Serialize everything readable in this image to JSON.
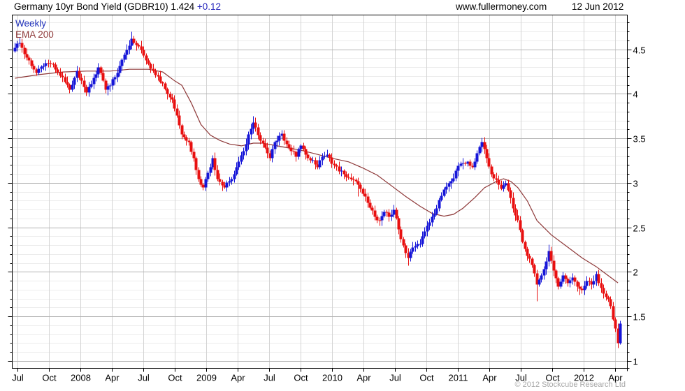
{
  "header": {
    "title": "Germany 10yr Bond Yield (GDBR10) 1.424",
    "change": "+0.12",
    "website": "www.fullermoney.com",
    "date": "12 Jun 2012"
  },
  "legend": {
    "frequency": "Weekly",
    "overlay": "EMA 200"
  },
  "footer": {
    "copyright": "© 2012 Stockcube Research Ltd"
  },
  "colors": {
    "up_candle": "#1616d8",
    "down_candle": "#e81010",
    "ema_line": "#8e3939",
    "accent_blue": "#2222bb",
    "grid_minor": "#ececec",
    "grid_major": "#b2b2b2",
    "grid_vertical": "#d4d4d4",
    "axis": "#000000",
    "copyright_gray": "#a6a6a6"
  },
  "chart_data": {
    "type": "candlestick",
    "title": "Germany 10yr Bond Yield (GDBR10)",
    "instrument": "Germany 10yr Bond Yield",
    "ticker": "GDBR10",
    "frequency": "Weekly",
    "overlay": "EMA 200",
    "last_price": 1.424,
    "change": "+0.12",
    "as_of_date": "12 Jun 2012",
    "legend_position": "top-left",
    "grid": true,
    "x_range_note": "weekly bars, Jul 2007 to 12 Jun 2012; t = weeks since first bar",
    "x_tick_labels": [
      "Jul",
      "Oct",
      "2008",
      "Apr",
      "Jul",
      "Oct",
      "2009",
      "Apr",
      "Jul",
      "Oct",
      "2010",
      "Apr",
      "Jul",
      "Oct",
      "2011",
      "Apr",
      "Jul",
      "Oct",
      "2012",
      "Apr"
    ],
    "y_tick_values": [
      1,
      1.5,
      2,
      2.5,
      3,
      3.5,
      4,
      4.5
    ],
    "y_minor_step": 0.1,
    "ylim": [
      0.92,
      4.89
    ],
    "weekly_close_anchors": [
      [
        0,
        4.52
      ],
      [
        2,
        4.58
      ],
      [
        4,
        4.45
      ],
      [
        6,
        4.38
      ],
      [
        9,
        4.24
      ],
      [
        12,
        4.32
      ],
      [
        15,
        4.34
      ],
      [
        18,
        4.25
      ],
      [
        21,
        4.14
      ],
      [
        23,
        4.05
      ],
      [
        26,
        4.26
      ],
      [
        28,
        4.15
      ],
      [
        30,
        4.02
      ],
      [
        33,
        4.18
      ],
      [
        35,
        4.3
      ],
      [
        38,
        4.05
      ],
      [
        40,
        4.1
      ],
      [
        43,
        4.24
      ],
      [
        46,
        4.44
      ],
      [
        49,
        4.62
      ],
      [
        51,
        4.55
      ],
      [
        53,
        4.5
      ],
      [
        55,
        4.38
      ],
      [
        58,
        4.26
      ],
      [
        60,
        4.2
      ],
      [
        63,
        4.06
      ],
      [
        66,
        3.94
      ],
      [
        68,
        3.76
      ],
      [
        70,
        3.55
      ],
      [
        73,
        3.46
      ],
      [
        75,
        3.28
      ],
      [
        77,
        3.05
      ],
      [
        79,
        2.95
      ],
      [
        81,
        3.12
      ],
      [
        83,
        3.28
      ],
      [
        85,
        3.05
      ],
      [
        88,
        2.95
      ],
      [
        90,
        3.02
      ],
      [
        92,
        3.1
      ],
      [
        94,
        3.24
      ],
      [
        96,
        3.36
      ],
      [
        98,
        3.55
      ],
      [
        100,
        3.68
      ],
      [
        102,
        3.54
      ],
      [
        105,
        3.4
      ],
      [
        107,
        3.28
      ],
      [
        109,
        3.46
      ],
      [
        112,
        3.56
      ],
      [
        114,
        3.44
      ],
      [
        116,
        3.36
      ],
      [
        118,
        3.3
      ],
      [
        120,
        3.42
      ],
      [
        122,
        3.32
      ],
      [
        125,
        3.26
      ],
      [
        127,
        3.18
      ],
      [
        129,
        3.3
      ],
      [
        131,
        3.32
      ],
      [
        134,
        3.2
      ],
      [
        138,
        3.1
      ],
      [
        141,
        3.05
      ],
      [
        144,
        2.98
      ],
      [
        146,
        2.88
      ],
      [
        148,
        2.78
      ],
      [
        151,
        2.62
      ],
      [
        153,
        2.58
      ],
      [
        155,
        2.68
      ],
      [
        157,
        2.62
      ],
      [
        159,
        2.7
      ],
      [
        161,
        2.48
      ],
      [
        163,
        2.3
      ],
      [
        165,
        2.16
      ],
      [
        167,
        2.28
      ],
      [
        170,
        2.32
      ],
      [
        172,
        2.46
      ],
      [
        174,
        2.56
      ],
      [
        177,
        2.72
      ],
      [
        179,
        2.86
      ],
      [
        181,
        2.96
      ],
      [
        183,
        3.02
      ],
      [
        185,
        3.14
      ],
      [
        187,
        3.22
      ],
      [
        190,
        3.24
      ],
      [
        192,
        3.18
      ],
      [
        194,
        3.34
      ],
      [
        196,
        3.46
      ],
      [
        198,
        3.28
      ],
      [
        200,
        3.1
      ],
      [
        202,
        3.04
      ],
      [
        204,
        2.94
      ],
      [
        206,
        3.0
      ],
      [
        209,
        2.72
      ],
      [
        211,
        2.58
      ],
      [
        213,
        2.34
      ],
      [
        215,
        2.18
      ],
      [
        217,
        2.08
      ],
      [
        219,
        1.86
      ],
      [
        221,
        1.96
      ],
      [
        223,
        2.12
      ],
      [
        224,
        2.24
      ],
      [
        226,
        2.02
      ],
      [
        228,
        1.84
      ],
      [
        230,
        1.96
      ],
      [
        232,
        1.88
      ],
      [
        234,
        1.94
      ],
      [
        236,
        1.84
      ],
      [
        238,
        1.8
      ],
      [
        240,
        1.9
      ],
      [
        242,
        1.86
      ],
      [
        244,
        1.98
      ],
      [
        245,
        1.88
      ],
      [
        246,
        1.82
      ],
      [
        247,
        1.76
      ],
      [
        248,
        1.72
      ],
      [
        249,
        1.7
      ],
      [
        250,
        1.62
      ],
      [
        251,
        1.47
      ],
      [
        252,
        1.37
      ],
      [
        253,
        1.2
      ],
      [
        254,
        1.42
      ]
    ],
    "extreme_wicks": [
      [
        2,
        "hi",
        4.63
      ],
      [
        49,
        "hi",
        4.7
      ],
      [
        100,
        "hi",
        3.75
      ],
      [
        144,
        "lo",
        2.85
      ],
      [
        165,
        "lo",
        2.07
      ],
      [
        196,
        "hi",
        3.51
      ],
      [
        219,
        "lo",
        1.67
      ],
      [
        224,
        "hi",
        2.31
      ],
      [
        237,
        "lo",
        1.74
      ],
      [
        253,
        "lo",
        1.16
      ],
      [
        254,
        "hi",
        1.45
      ]
    ],
    "ema_points": [
      [
        0,
        4.18
      ],
      [
        10,
        4.22
      ],
      [
        20,
        4.25
      ],
      [
        30,
        4.26
      ],
      [
        40,
        4.26
      ],
      [
        48,
        4.28
      ],
      [
        56,
        4.28
      ],
      [
        62,
        4.25
      ],
      [
        67,
        4.15
      ],
      [
        70,
        4.1
      ],
      [
        74,
        3.9
      ],
      [
        78,
        3.66
      ],
      [
        82,
        3.54
      ],
      [
        86,
        3.48
      ],
      [
        90,
        3.44
      ],
      [
        95,
        3.42
      ],
      [
        100,
        3.45
      ],
      [
        104,
        3.45
      ],
      [
        108,
        3.43
      ],
      [
        114,
        3.4
      ],
      [
        120,
        3.37
      ],
      [
        126,
        3.33
      ],
      [
        133,
        3.28
      ],
      [
        140,
        3.24
      ],
      [
        146,
        3.17
      ],
      [
        152,
        3.09
      ],
      [
        158,
        2.97
      ],
      [
        164,
        2.85
      ],
      [
        170,
        2.74
      ],
      [
        175,
        2.66
      ],
      [
        180,
        2.63
      ],
      [
        184,
        2.65
      ],
      [
        188,
        2.72
      ],
      [
        193,
        2.84
      ],
      [
        197,
        2.95
      ],
      [
        202,
        3.02
      ],
      [
        205,
        3.05
      ],
      [
        208,
        3.02
      ],
      [
        211,
        2.95
      ],
      [
        215,
        2.8
      ],
      [
        219,
        2.58
      ],
      [
        225,
        2.42
      ],
      [
        231,
        2.3
      ],
      [
        238,
        2.16
      ],
      [
        244,
        2.06
      ],
      [
        248,
        1.98
      ],
      [
        253,
        1.88
      ]
    ]
  }
}
